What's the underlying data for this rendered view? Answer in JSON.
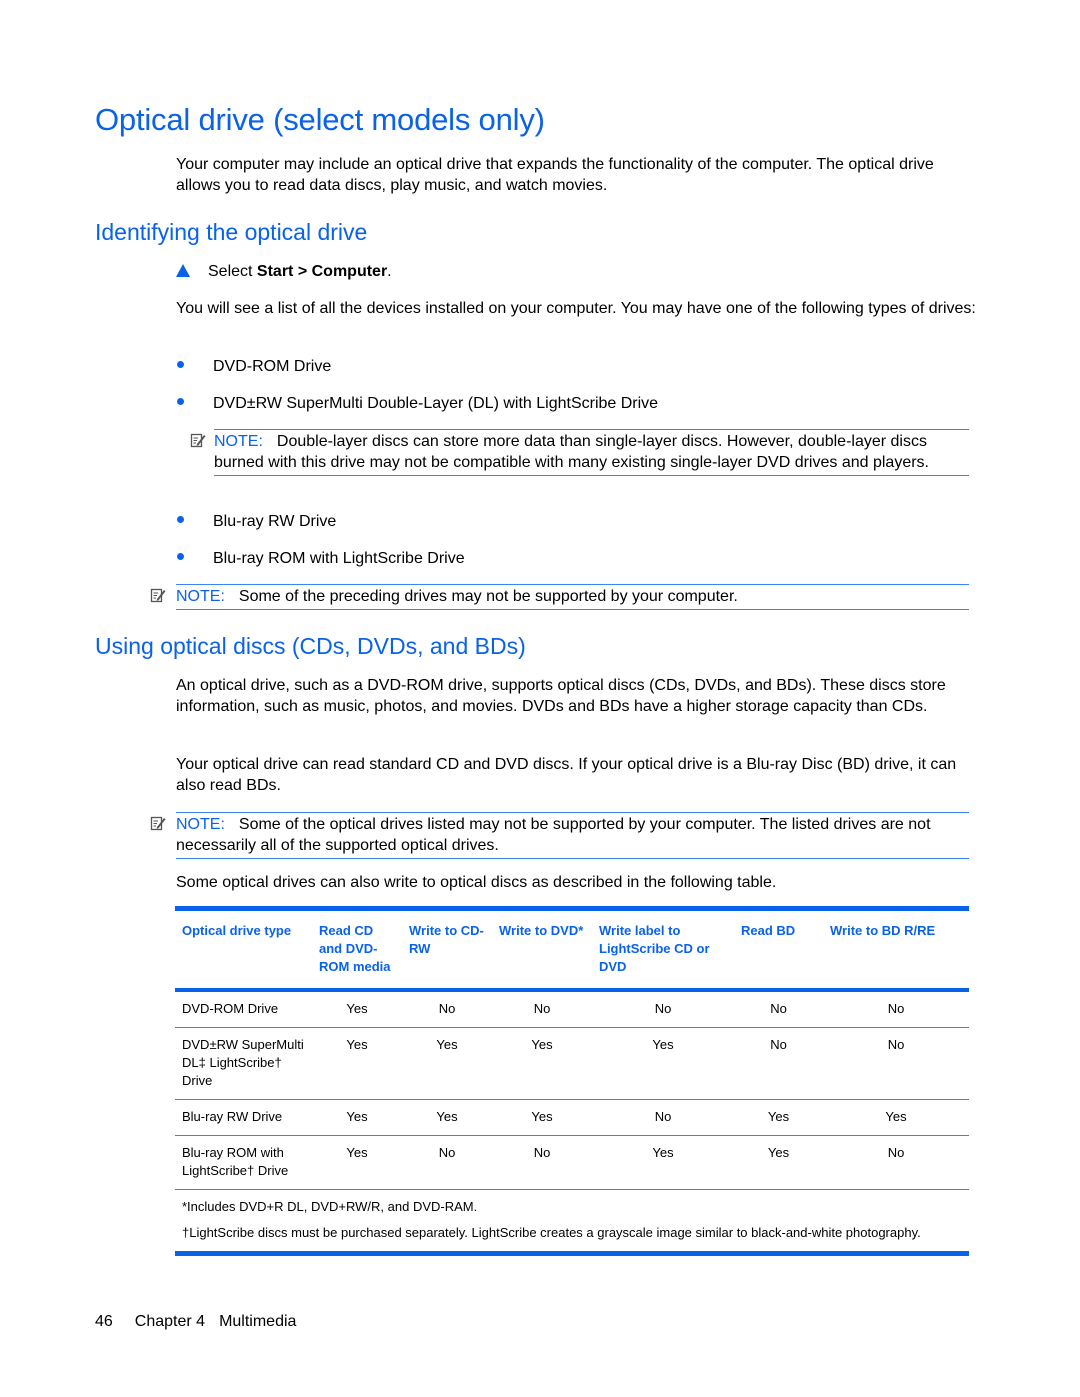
{
  "page": {
    "title": "Optical drive (select models only)",
    "intro": "Your computer may include an optical drive that expands the functionality of the computer. The optical drive allows you to read data discs, play music, and watch movies."
  },
  "identify": {
    "heading": "Identifying the optical drive",
    "step_prefix": "Select ",
    "step_bold": "Start > Computer",
    "step_suffix": ".",
    "para": "You will see a list of all the devices installed on your computer. You may have one of the following types of drives:",
    "bullets": [
      "DVD-ROM Drive",
      "DVD±RW SuperMulti Double-Layer (DL) with LightScribe Drive",
      "Blu-ray RW Drive",
      "Blu-ray ROM with LightScribe Drive"
    ],
    "note_inline": {
      "label": "NOTE:",
      "text": "Double-layer discs can store more data than single-layer discs. However, double-layer discs burned with this drive may not be compatible with many existing single-layer DVD drives and players."
    },
    "note_after": {
      "label": "NOTE:",
      "text": "Some of the preceding drives may not be supported by your computer."
    }
  },
  "using": {
    "heading": "Using optical discs (CDs, DVDs, and BDs)",
    "para1": "An optical drive, such as a DVD-ROM drive, supports optical discs (CDs, DVDs, and BDs). These discs store information, such as music, photos, and movies. DVDs and BDs have a higher storage capacity than CDs.",
    "para2": "Your optical drive can read standard CD and DVD discs. If your optical drive is a Blu-ray Disc (BD) drive, it can also read BDs.",
    "note": {
      "label": "NOTE:",
      "text": "Some of the optical drives listed may not be supported by your computer. The listed drives are not necessarily all of the supported optical drives."
    },
    "para3": "Some optical drives can also write to optical discs as described in the following table."
  },
  "table": {
    "headers": [
      "Optical drive type",
      "Read CD and DVD-ROM media",
      "Write to CD-RW",
      "Write to DVD*",
      "Write label to LightScribe CD or DVD",
      "Read BD",
      "Write to BD R/RE"
    ],
    "rows": [
      [
        "DVD-ROM Drive",
        "Yes",
        "No",
        "No",
        "No",
        "No",
        "No"
      ],
      [
        "DVD±RW SuperMulti DL‡ LightScribe† Drive",
        "Yes",
        "Yes",
        "Yes",
        "Yes",
        "No",
        "No"
      ],
      [
        "Blu-ray RW Drive",
        "Yes",
        "Yes",
        "Yes",
        "No",
        "Yes",
        "Yes"
      ],
      [
        "Blu-ray ROM with LightScribe† Drive",
        "Yes",
        "No",
        "No",
        "Yes",
        "Yes",
        "No"
      ]
    ],
    "footnotes": [
      "*Includes DVD+R DL, DVD+RW/R, and DVD-RAM.",
      "†LightScribe discs must be purchased separately. LightScribe creates a grayscale image similar to black-and-white photography."
    ]
  },
  "footer": {
    "page_number": "46",
    "chapter": "Chapter 4",
    "chapter_title": "Multimedia"
  },
  "colors": {
    "accent": "#0a62e8",
    "rule": "#3a86f0"
  }
}
